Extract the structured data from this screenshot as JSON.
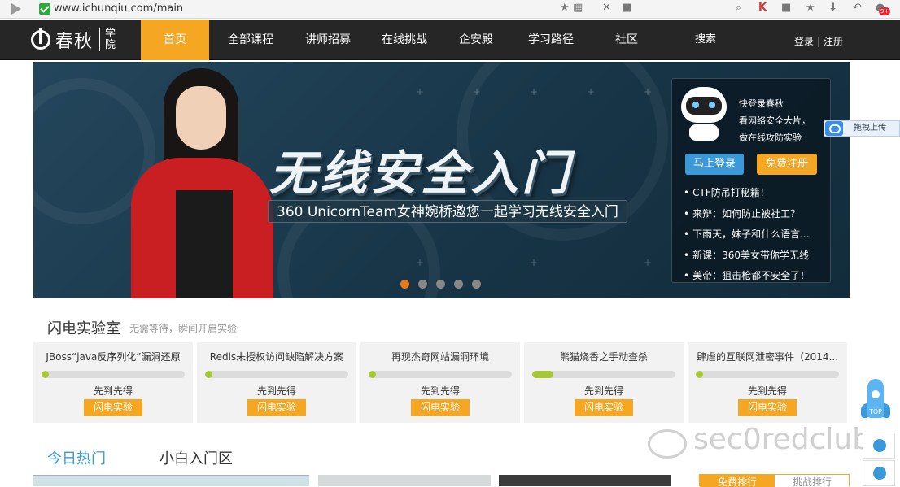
{
  "browser": {
    "url": "www.ichunqiu.com/main",
    "icons": [
      "star-icon",
      "qr-icon",
      "close-icon",
      "paw-icon",
      "search-icon",
      "k-icon",
      "lock-icon",
      "favorite-icon",
      "download-icon",
      "back-icon",
      "message-icon"
    ],
    "notification_count": "9+"
  },
  "header": {
    "logo_text": "春秋",
    "logo_sub": "学院",
    "nav": [
      "首页",
      "全部课程",
      "讲师招募",
      "在线挑战",
      "企安殿",
      "学习路径",
      "社区",
      "搜索"
    ],
    "active_index": 0,
    "login": "登录",
    "register": "注册",
    "accent": "#f5a623"
  },
  "banner": {
    "title": "无线安全入门",
    "subtitle": "360 UnicornTeam女神婉桥邀您一起学习无线安全入门",
    "slide_count": 5,
    "active_slide": 0
  },
  "panel": {
    "lines": [
      "快登录春秋",
      "看网络安全大片，",
      "做在线攻防实验"
    ],
    "login_btn": "马上登录",
    "register_btn": "免费注册",
    "news": [
      "CTF防吊打秘籍！",
      "来辩：如何防止被社工？",
      "下雨天，妹子和什么语言...",
      "新课：360美女带你学无线",
      "美帝：狙击枪都不安全了！"
    ]
  },
  "side": {
    "upload": "拖拽上传",
    "rocket_label": "TOP",
    "watermark": "sec0redclub"
  },
  "lab": {
    "title": "闪电实验室",
    "subtitle": "无需等待，瞬间开启实验",
    "cards": [
      {
        "name": "JBoss“java反序列化”漏洞还原",
        "status": "先到先得",
        "button": "闪电实验",
        "progress": 0.05
      },
      {
        "name": "Redis未授权访问缺陷解决方案",
        "status": "先到先得",
        "button": "闪电实验",
        "progress": 0.05
      },
      {
        "name": "再现杰奇网站漏洞环境",
        "status": "先到先得",
        "button": "闪电实验",
        "progress": 0.05
      },
      {
        "name": "熊猫烧香之手动查杀",
        "status": "先到先得",
        "button": "闪电实验",
        "progress": 0.15
      },
      {
        "name": "肆虐的互联网泄密事件（2014...",
        "status": "先到先得",
        "button": "闪电实验",
        "progress": 0.05
      }
    ]
  },
  "tabs": {
    "hot": "今日热门",
    "beginner": "小白入门区",
    "rank_a": "免费排行",
    "rank_b": "挑战排行"
  }
}
